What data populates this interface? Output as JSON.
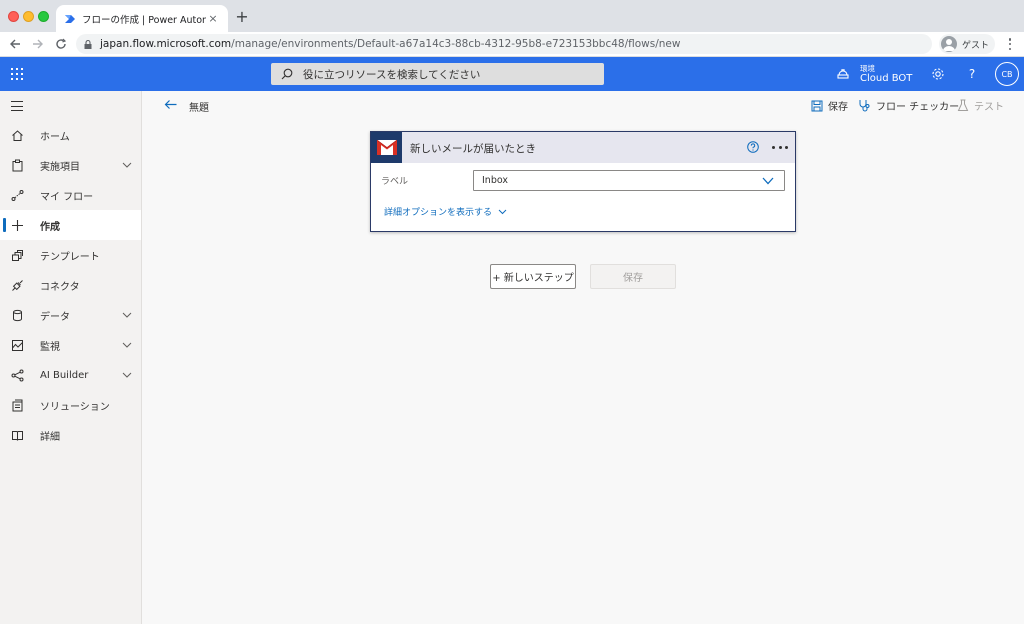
{
  "browser": {
    "tab_title": "フローの作成 | Power Automate",
    "tab_close": "×",
    "new_tab": "+",
    "url_host": "japan.flow.microsoft.com",
    "url_path": "/manage/environments/Default-a67a14c3-88cb-4312-95b8-e723153bbc48/flows/new",
    "profile_label": "ゲスト"
  },
  "header": {
    "search_placeholder": "役に立つリソースを検索してください",
    "env_label": "環境",
    "env_name": "Cloud BOT",
    "help": "?",
    "avatar_initials": "CB",
    "accent": "#2b6fe9"
  },
  "sidebar": {
    "items": [
      {
        "label": "ホーム",
        "icon": "home-icon",
        "chevron": false
      },
      {
        "label": "実施項目",
        "icon": "clipboard-icon",
        "chevron": true
      },
      {
        "label": "マイ フロー",
        "icon": "flow-icon",
        "chevron": false
      },
      {
        "label": "作成",
        "icon": "plus-icon",
        "chevron": false,
        "active": true
      },
      {
        "label": "テンプレート",
        "icon": "template-icon",
        "chevron": false
      },
      {
        "label": "コネクタ",
        "icon": "connector-icon",
        "chevron": false
      },
      {
        "label": "データ",
        "icon": "database-icon",
        "chevron": true
      },
      {
        "label": "監視",
        "icon": "monitor-icon",
        "chevron": true
      },
      {
        "label": "AI Builder",
        "icon": "ai-builder-icon",
        "chevron": true
      },
      {
        "label": "ソリューション",
        "icon": "solution-icon",
        "chevron": false
      },
      {
        "label": "詳細",
        "icon": "book-icon",
        "chevron": false
      }
    ]
  },
  "commandbar": {
    "title": "無題",
    "save": "保存",
    "checker": "フロー チェッカー",
    "test": "テスト"
  },
  "card": {
    "title": "新しいメールが届いたとき",
    "label_field": "ラベル",
    "label_value": "Inbox",
    "advanced": "詳細オプションを表示する"
  },
  "buttons": {
    "new_step": "+ 新しいステップ",
    "save": "保存"
  }
}
